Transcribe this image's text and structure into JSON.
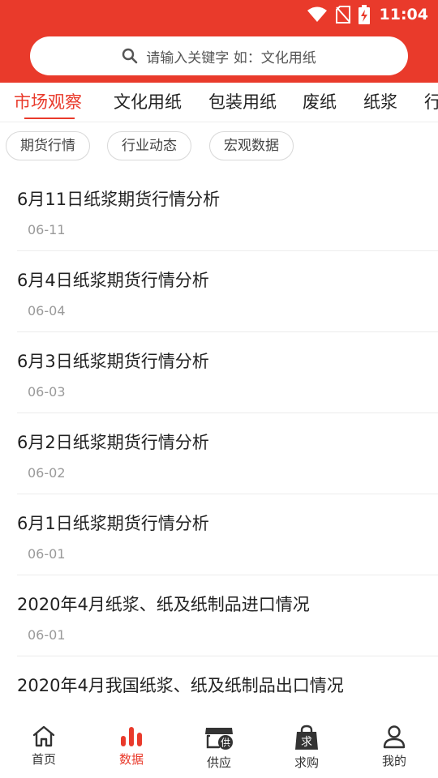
{
  "status_bar": {
    "time": "11:04"
  },
  "search": {
    "placeholder": "请输入关键字  如：文化用纸"
  },
  "tabs": [
    {
      "label": "市场观察",
      "active": true
    },
    {
      "label": "文化用纸"
    },
    {
      "label": "包装用纸"
    },
    {
      "label": "废纸"
    },
    {
      "label": "纸浆"
    },
    {
      "label": "行"
    }
  ],
  "chips": [
    {
      "label": "期货行情"
    },
    {
      "label": "行业动态"
    },
    {
      "label": "宏观数据"
    }
  ],
  "articles": [
    {
      "title": "6月11日纸浆期货行情分析",
      "date": "06-11"
    },
    {
      "title": "6月4日纸浆期货行情分析",
      "date": "06-04"
    },
    {
      "title": "6月3日纸浆期货行情分析",
      "date": "06-03"
    },
    {
      "title": "6月2日纸浆期货行情分析",
      "date": "06-02"
    },
    {
      "title": "6月1日纸浆期货行情分析",
      "date": "06-01"
    },
    {
      "title": "2020年4月纸浆、纸及纸制品进口情况",
      "date": "06-01"
    },
    {
      "title": "2020年4月我国纸浆、纸及纸制品出口情况",
      "date": ""
    }
  ],
  "bottom_nav": [
    {
      "label": "首页",
      "icon": "home-icon"
    },
    {
      "label": "数据",
      "icon": "bar-chart-icon",
      "active": true
    },
    {
      "label": "供应",
      "icon": "store-icon",
      "badge": "供"
    },
    {
      "label": "求购",
      "icon": "shopping-bag-icon",
      "badge": "求"
    },
    {
      "label": "我的",
      "icon": "user-icon"
    }
  ],
  "colors": {
    "accent": "#e93a2b",
    "text": "#222222",
    "muted": "#9a9a9a"
  }
}
